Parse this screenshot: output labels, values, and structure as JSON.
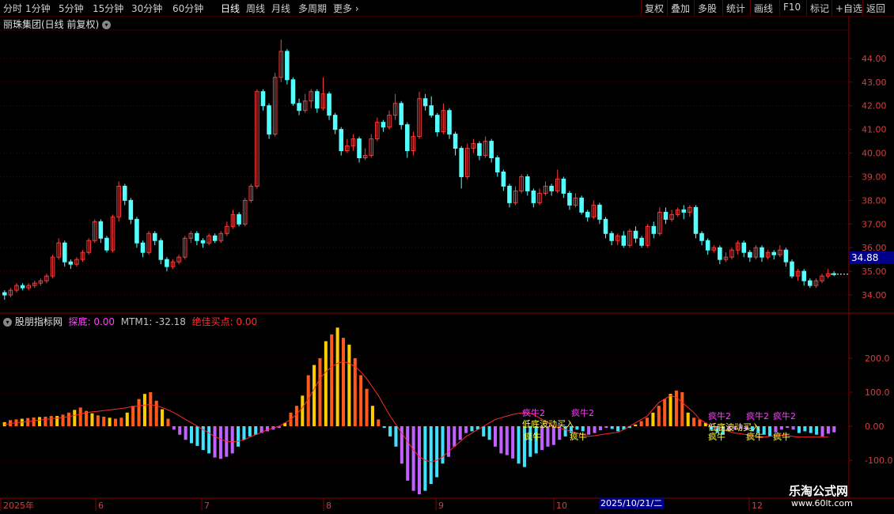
{
  "toolbar": {
    "periods": [
      "分时",
      "1分钟",
      "5分钟",
      "15分钟",
      "30分钟",
      "60分钟",
      "日线",
      "周线",
      "月线",
      "多周期",
      "更多"
    ],
    "active_period": "日线",
    "actions": [
      "复权",
      "叠加",
      "多股",
      "统计",
      "画线",
      "F10",
      "标记",
      "+自选",
      "返回"
    ]
  },
  "stock": {
    "title": "丽珠集团(日线 前复权)",
    "current_price": "34.88"
  },
  "price_axis": [
    "44.00",
    "43.00",
    "42.00",
    "41.00",
    "40.00",
    "39.00",
    "38.00",
    "37.00",
    "36.00",
    "35.00",
    "34.00"
  ],
  "indicator": {
    "name": "股朋指标网",
    "tandi_label": "探底: 0.00",
    "mtm_label": "MTM1: -32.18",
    "buy_label": "绝佳买点: 0.00",
    "axis": [
      "200.0",
      "100.0",
      "0.00",
      "-100.0"
    ]
  },
  "signals": {
    "crazy_bull2": "疯牛2",
    "crazy_bull": "疯牛",
    "wave_buy": "低底波动买入"
  },
  "date_axis": [
    "2025年",
    "6",
    "7",
    "8",
    "9",
    "10",
    "12"
  ],
  "cursor_date": "2025/10/21/二",
  "watermark": {
    "name": "乐淘公式网",
    "url": "www.60lt.com"
  },
  "chart_data": [
    {
      "type": "candlestick",
      "title": "丽珠集团(日线 前复权)",
      "ylim": [
        33.5,
        45.0
      ],
      "y_ticks": [
        34,
        35,
        36,
        37,
        38,
        39,
        40,
        41,
        42,
        43,
        44
      ],
      "candles": [
        [
          34.1,
          34.0,
          34.2,
          33.8
        ],
        [
          34.0,
          34.2,
          34.3,
          33.9
        ],
        [
          34.2,
          34.4,
          34.5,
          34.1
        ],
        [
          34.4,
          34.3,
          34.5,
          34.2
        ],
        [
          34.3,
          34.4,
          34.5,
          34.2
        ],
        [
          34.4,
          34.5,
          34.6,
          34.3
        ],
        [
          34.5,
          34.6,
          34.7,
          34.4
        ],
        [
          34.6,
          34.8,
          34.9,
          34.5
        ],
        [
          34.8,
          35.6,
          35.7,
          34.7
        ],
        [
          35.6,
          36.2,
          36.4,
          35.5
        ],
        [
          36.2,
          35.4,
          36.3,
          35.2
        ],
        [
          35.4,
          35.3,
          35.5,
          35.1
        ],
        [
          35.3,
          35.5,
          35.6,
          35.2
        ],
        [
          35.5,
          35.8,
          35.9,
          35.4
        ],
        [
          35.8,
          36.3,
          36.4,
          35.7
        ],
        [
          36.3,
          37.1,
          37.2,
          36.2
        ],
        [
          37.1,
          36.4,
          37.2,
          36.2
        ],
        [
          36.4,
          35.9,
          36.5,
          35.8
        ],
        [
          35.9,
          37.3,
          37.4,
          35.8
        ],
        [
          37.3,
          38.6,
          38.8,
          37.1
        ],
        [
          38.6,
          38.0,
          38.7,
          37.8
        ],
        [
          38.0,
          37.2,
          38.1,
          37.0
        ],
        [
          37.2,
          36.2,
          37.3,
          36.0
        ],
        [
          36.2,
          35.8,
          36.3,
          35.6
        ],
        [
          35.8,
          36.6,
          36.7,
          35.7
        ],
        [
          36.6,
          36.3,
          36.7,
          36.1
        ],
        [
          36.3,
          35.5,
          36.4,
          35.3
        ],
        [
          35.5,
          35.2,
          35.6,
          35.0
        ],
        [
          35.2,
          35.4,
          35.5,
          35.1
        ],
        [
          35.4,
          35.6,
          35.7,
          35.3
        ],
        [
          35.6,
          36.4,
          36.5,
          35.5
        ],
        [
          36.4,
          36.6,
          36.7,
          36.2
        ],
        [
          36.6,
          36.3,
          36.7,
          36.1
        ],
        [
          36.3,
          36.2,
          36.4,
          36.0
        ],
        [
          36.2,
          36.5,
          36.6,
          36.1
        ],
        [
          36.5,
          36.3,
          36.6,
          36.2
        ],
        [
          36.3,
          36.6,
          36.7,
          36.2
        ],
        [
          36.6,
          36.9,
          37.1,
          36.5
        ],
        [
          36.9,
          37.4,
          37.6,
          36.8
        ],
        [
          37.4,
          37.0,
          37.5,
          36.9
        ],
        [
          37.0,
          38.0,
          38.1,
          36.9
        ],
        [
          38.0,
          38.6,
          38.7,
          37.9
        ],
        [
          38.6,
          42.6,
          42.7,
          38.5
        ],
        [
          42.6,
          42.0,
          42.7,
          41.8
        ],
        [
          42.0,
          40.8,
          42.1,
          40.6
        ],
        [
          40.8,
          43.2,
          43.4,
          40.7
        ],
        [
          43.2,
          44.3,
          44.8,
          43.0
        ],
        [
          44.3,
          43.1,
          44.4,
          42.9
        ],
        [
          43.1,
          42.1,
          43.2,
          42.0
        ],
        [
          42.1,
          41.8,
          42.3,
          41.6
        ],
        [
          41.8,
          42.2,
          42.5,
          41.7
        ],
        [
          42.2,
          42.6,
          42.7,
          41.9
        ],
        [
          42.6,
          41.9,
          42.7,
          41.7
        ],
        [
          41.9,
          42.5,
          43.2,
          41.8
        ],
        [
          42.5,
          41.6,
          42.6,
          41.4
        ],
        [
          41.6,
          41.0,
          41.7,
          40.8
        ],
        [
          41.0,
          40.1,
          41.1,
          39.9
        ],
        [
          40.1,
          40.3,
          40.6,
          40.0
        ],
        [
          40.3,
          40.6,
          40.8,
          40.1
        ],
        [
          40.6,
          39.8,
          40.7,
          39.6
        ],
        [
          39.8,
          39.9,
          40.2,
          39.7
        ],
        [
          39.9,
          40.6,
          40.8,
          39.8
        ],
        [
          40.6,
          41.3,
          41.5,
          40.5
        ],
        [
          41.3,
          41.1,
          41.4,
          40.9
        ],
        [
          41.1,
          41.6,
          41.8,
          41.0
        ],
        [
          41.6,
          42.1,
          42.5,
          41.4
        ],
        [
          42.1,
          41.2,
          42.2,
          41.0
        ],
        [
          41.2,
          40.1,
          41.3,
          39.8
        ],
        [
          40.1,
          40.7,
          40.9,
          39.9
        ],
        [
          40.7,
          42.3,
          42.6,
          40.6
        ],
        [
          42.3,
          42.0,
          42.5,
          41.8
        ],
        [
          42.0,
          41.6,
          42.4,
          41.5
        ],
        [
          41.6,
          40.9,
          41.7,
          40.7
        ],
        [
          40.9,
          41.8,
          42.1,
          40.8
        ],
        [
          41.8,
          40.8,
          41.9,
          40.6
        ],
        [
          40.8,
          40.2,
          40.9,
          39.9
        ],
        [
          40.2,
          39.0,
          40.3,
          38.5
        ],
        [
          39.0,
          40.2,
          40.4,
          38.9
        ],
        [
          40.2,
          40.4,
          40.6,
          40.0
        ],
        [
          40.4,
          39.9,
          40.5,
          39.7
        ],
        [
          39.9,
          40.5,
          40.7,
          39.8
        ],
        [
          40.5,
          39.8,
          40.6,
          39.6
        ],
        [
          39.8,
          39.2,
          39.9,
          39.0
        ],
        [
          39.2,
          38.6,
          39.3,
          38.4
        ],
        [
          38.6,
          37.9,
          38.7,
          37.7
        ],
        [
          37.9,
          38.4,
          38.6,
          37.8
        ],
        [
          38.4,
          39.0,
          39.1,
          38.3
        ],
        [
          39.0,
          38.4,
          39.1,
          38.2
        ],
        [
          38.4,
          37.9,
          38.5,
          37.7
        ],
        [
          37.9,
          38.3,
          38.5,
          37.8
        ],
        [
          38.3,
          38.6,
          38.8,
          38.2
        ],
        [
          38.6,
          38.4,
          38.7,
          38.2
        ],
        [
          38.4,
          38.9,
          39.3,
          38.3
        ],
        [
          38.9,
          38.3,
          39.0,
          38.1
        ],
        [
          38.3,
          37.8,
          38.4,
          37.6
        ],
        [
          37.8,
          38.1,
          38.3,
          37.7
        ],
        [
          38.1,
          37.5,
          38.2,
          37.4
        ],
        [
          37.5,
          37.3,
          37.6,
          37.1
        ],
        [
          37.3,
          37.8,
          38.0,
          37.2
        ],
        [
          37.8,
          37.2,
          37.9,
          37.0
        ],
        [
          37.2,
          36.6,
          37.3,
          36.4
        ],
        [
          36.6,
          36.3,
          36.7,
          36.1
        ],
        [
          36.3,
          36.5,
          36.6,
          36.1
        ],
        [
          36.5,
          36.1,
          36.7,
          36.0
        ],
        [
          36.1,
          36.7,
          36.8,
          36.0
        ],
        [
          36.7,
          36.4,
          36.9,
          36.2
        ],
        [
          36.4,
          36.1,
          36.5,
          36.0
        ],
        [
          36.1,
          36.9,
          37.0,
          36.0
        ],
        [
          36.9,
          36.6,
          37.1,
          36.4
        ],
        [
          36.6,
          37.5,
          37.7,
          36.5
        ],
        [
          37.5,
          37.2,
          37.7,
          37.0
        ],
        [
          37.2,
          37.4,
          37.6,
          37.1
        ],
        [
          37.4,
          37.6,
          37.7,
          37.3
        ],
        [
          37.6,
          37.5,
          37.8,
          37.2
        ],
        [
          37.5,
          37.7,
          37.8,
          37.3
        ],
        [
          37.7,
          36.6,
          37.8,
          36.4
        ],
        [
          36.6,
          36.3,
          36.7,
          36.1
        ],
        [
          36.3,
          35.9,
          36.4,
          35.7
        ],
        [
          35.9,
          36.0,
          36.1,
          35.8
        ],
        [
          36.0,
          35.5,
          36.1,
          35.3
        ],
        [
          35.5,
          35.6,
          35.8,
          35.4
        ],
        [
          35.6,
          35.9,
          36.0,
          35.5
        ],
        [
          35.9,
          36.2,
          36.3,
          35.7
        ],
        [
          36.2,
          35.8,
          36.3,
          35.6
        ],
        [
          35.8,
          35.6,
          35.9,
          35.4
        ],
        [
          35.6,
          36.0,
          36.1,
          35.5
        ],
        [
          36.0,
          35.6,
          36.1,
          35.4
        ],
        [
          35.6,
          35.8,
          35.9,
          35.5
        ],
        [
          35.8,
          35.7,
          35.9,
          35.5
        ],
        [
          35.7,
          35.9,
          36.1,
          35.6
        ],
        [
          35.9,
          35.4,
          36.0,
          35.2
        ],
        [
          35.4,
          34.8,
          35.5,
          34.7
        ],
        [
          34.8,
          35.0,
          35.1,
          34.6
        ],
        [
          35.0,
          34.6,
          35.1,
          34.4
        ],
        [
          34.6,
          34.4,
          34.7,
          34.3
        ],
        [
          34.4,
          34.6,
          34.7,
          34.3
        ],
        [
          34.6,
          34.8,
          34.9,
          34.5
        ],
        [
          34.8,
          34.9,
          35.1,
          34.7
        ],
        [
          34.9,
          34.88,
          35.0,
          34.8
        ]
      ]
    },
    {
      "type": "bar",
      "title": "股朋指标网",
      "ylim": [
        -200,
        300
      ],
      "y_ticks": [
        -100,
        0,
        100,
        200
      ],
      "mtm_value": -32.18,
      "bars": [
        12,
        18,
        20,
        22,
        24,
        26,
        27,
        28,
        30,
        30,
        34,
        40,
        48,
        55,
        45,
        38,
        32,
        28,
        25,
        22,
        25,
        40,
        60,
        80,
        95,
        100,
        75,
        50,
        22,
        -10,
        -25,
        -40,
        -50,
        -58,
        -70,
        -80,
        -92,
        -96,
        -90,
        -80,
        -60,
        -40,
        -30,
        -25,
        -20,
        -15,
        -10,
        -5,
        10,
        40,
        60,
        90,
        150,
        180,
        200,
        250,
        270,
        290,
        260,
        240,
        200,
        150,
        110,
        60,
        20,
        -5,
        -30,
        -60,
        -110,
        -160,
        -190,
        -200,
        -190,
        -170,
        -150,
        -110,
        -90,
        -60,
        -40,
        -20,
        -15,
        -10,
        -30,
        -40,
        -60,
        -80,
        -85,
        -95,
        -110,
        -120,
        -90,
        -80,
        -70,
        -60,
        -55,
        -40,
        -30,
        -20,
        -10,
        -15,
        -25,
        -20,
        -12,
        -5,
        -8,
        -15,
        -10,
        -5,
        5,
        15,
        25,
        40,
        60,
        80,
        95,
        105,
        100,
        40,
        25,
        20,
        10,
        -10,
        -20,
        -25,
        -15,
        -10,
        -8,
        -12,
        -15,
        -20,
        -25,
        -30,
        -18,
        -10,
        -5,
        -10,
        -20,
        -15,
        -20,
        -25,
        -30,
        -22,
        -18
      ],
      "mtm_line": [
        5,
        8,
        10,
        12,
        14,
        16,
        18,
        20,
        22,
        24,
        26,
        28,
        32,
        36,
        40,
        42,
        44,
        46,
        48,
        50,
        52,
        55,
        58,
        60,
        62,
        64,
        60,
        55,
        48,
        40,
        30,
        20,
        10,
        0,
        -10,
        -20,
        -30,
        -38,
        -44,
        -46,
        -44,
        -40,
        -32,
        -25,
        -18,
        -10,
        -5,
        0,
        10,
        20,
        35,
        55,
        80,
        110,
        140,
        160,
        175,
        185,
        190,
        185,
        175,
        160,
        140,
        115,
        90,
        60,
        30,
        5,
        -20,
        -45,
        -70,
        -90,
        -100,
        -105,
        -100,
        -90,
        -75,
        -60,
        -45,
        -30,
        -20,
        -10,
        0,
        10,
        20,
        25,
        30,
        35,
        38,
        40,
        38,
        30,
        20,
        10,
        0,
        -5,
        -10,
        -15,
        -20,
        -25,
        -30,
        -28,
        -25,
        -22,
        -20,
        -18,
        -10,
        0,
        10,
        20,
        30,
        50,
        70,
        80,
        90,
        85,
        70,
        55,
        40,
        20,
        10,
        0,
        -5,
        -10,
        -15,
        -20,
        -22,
        -25,
        -28,
        -30,
        -32,
        -30,
        -28,
        -26,
        -28,
        -30,
        -32,
        -32,
        -32,
        -32,
        -32,
        -32.18
      ],
      "colors": {
        "up_hot": "#ff5a1e",
        "up_warm": "#ffcc00",
        "down_cyan": "#40e0ff",
        "down_purple": "#c060ff",
        "line": "#ff2a2a"
      }
    }
  ]
}
